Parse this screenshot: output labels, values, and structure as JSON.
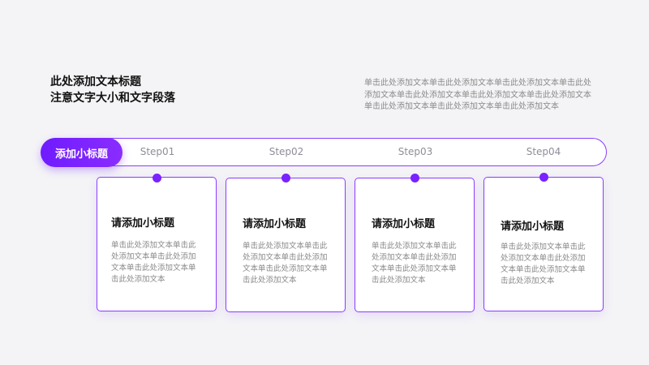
{
  "header": {
    "title_lines": [
      "此处添加文本标题",
      "注意文字大小和文字段落"
    ],
    "description_lines": [
      "单击此处添加文本单击此处添加文本单击此处添加文本单击此处",
      "添加文本单击此处添加文本单击此处添加文本单击此处添加文本",
      "单击此处添加文本单击此处添加文本单击此处添加文本"
    ]
  },
  "timeline": {
    "highlight_label": "添加小标题",
    "steps": [
      "Step01",
      "Step02",
      "Step03",
      "Step04"
    ]
  },
  "cards": [
    {
      "title": "请添加小标题",
      "body_lines": [
        "单击此处添加文本单击此",
        "处添加文本单击此处添加",
        "文本单击此处添加文本单",
        "击此处添加文本"
      ]
    },
    {
      "title": "请添加小标题",
      "body_lines": [
        "单击此处添加文本单击此",
        "处添加文本单击此处添加",
        "文本单击此处添加文本单",
        "击此处添加文本"
      ]
    },
    {
      "title": "请添加小标题",
      "body_lines": [
        "单击此处添加文本单击此",
        "处添加文本单击此处添加",
        "文本单击此处添加文本单",
        "击此处添加文本"
      ]
    },
    {
      "title": "请添加小标题",
      "body_lines": [
        "单击此处添加文本单击此",
        "处添加文本单击此处添加",
        "文本单击此处添加文本单",
        "击此处添加文本"
      ]
    }
  ],
  "colors": {
    "accent": "#7a22ff",
    "border": "#8b3dff",
    "background": "#f4f4f6"
  }
}
